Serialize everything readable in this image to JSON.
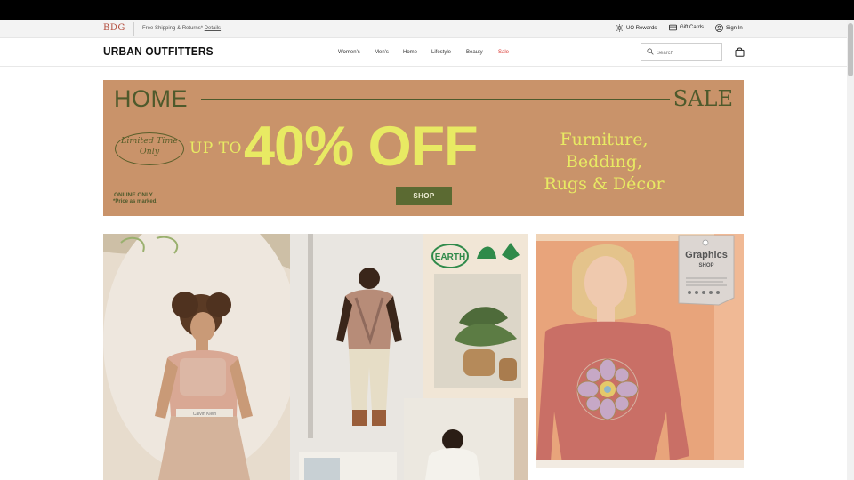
{
  "utility_bar": {
    "brand_mark": "BDG",
    "shipping_text": "Free Shipping & Returns*",
    "details_link": "Details",
    "rewards": "UO Rewards",
    "gift_cards": "Gift Cards",
    "sign_in": "Sign In"
  },
  "header": {
    "logo": "URBAN OUTFITTERS",
    "nav": [
      "Women's",
      "Men's",
      "Home",
      "Lifestyle",
      "Beauty",
      "Sale"
    ],
    "search_placeholder": "Search"
  },
  "hero_banner": {
    "home": "HOME",
    "sale": "SALE",
    "limited": "Limited Time Only",
    "up_to": "UP TO",
    "offer": "40% OFF",
    "categories_line1": "Furniture, Bedding,",
    "categories_line2": "Rugs & Décor",
    "online_only": "ONLINE ONLY",
    "price_note": "*Price as marked.",
    "shop_button": "SHOP",
    "colors": {
      "background": "#c9936a",
      "accent": "#e8ea63",
      "olive": "#4e5a2c"
    }
  },
  "collage": {
    "earth_badge": "EARTH",
    "waistband": "Calvin Klein"
  },
  "graphics_tile": {
    "tag_title": "Graphics",
    "tag_subtitle": "SHOP"
  }
}
